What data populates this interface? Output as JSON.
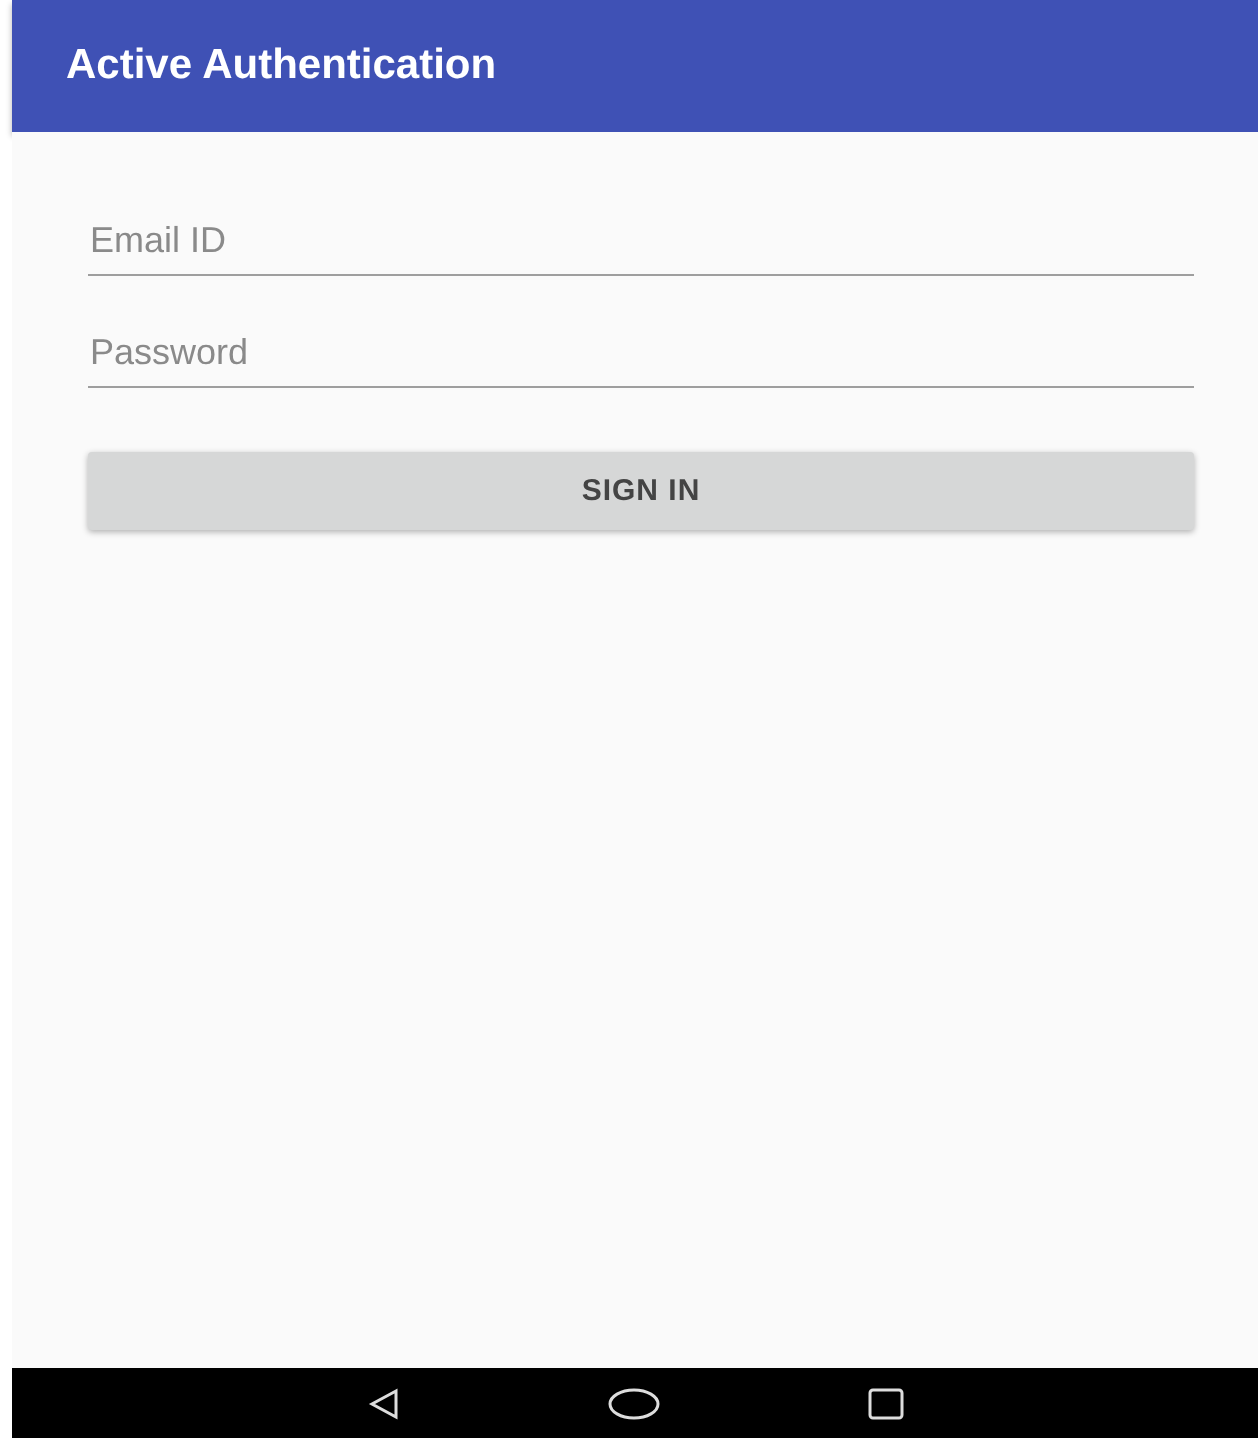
{
  "app_bar": {
    "title": "Active Authentication"
  },
  "email_field": {
    "placeholder": "Email ID"
  },
  "password_field": {
    "placeholder": "Password"
  },
  "sign_in_button": {
    "label": "SIGN IN"
  }
}
